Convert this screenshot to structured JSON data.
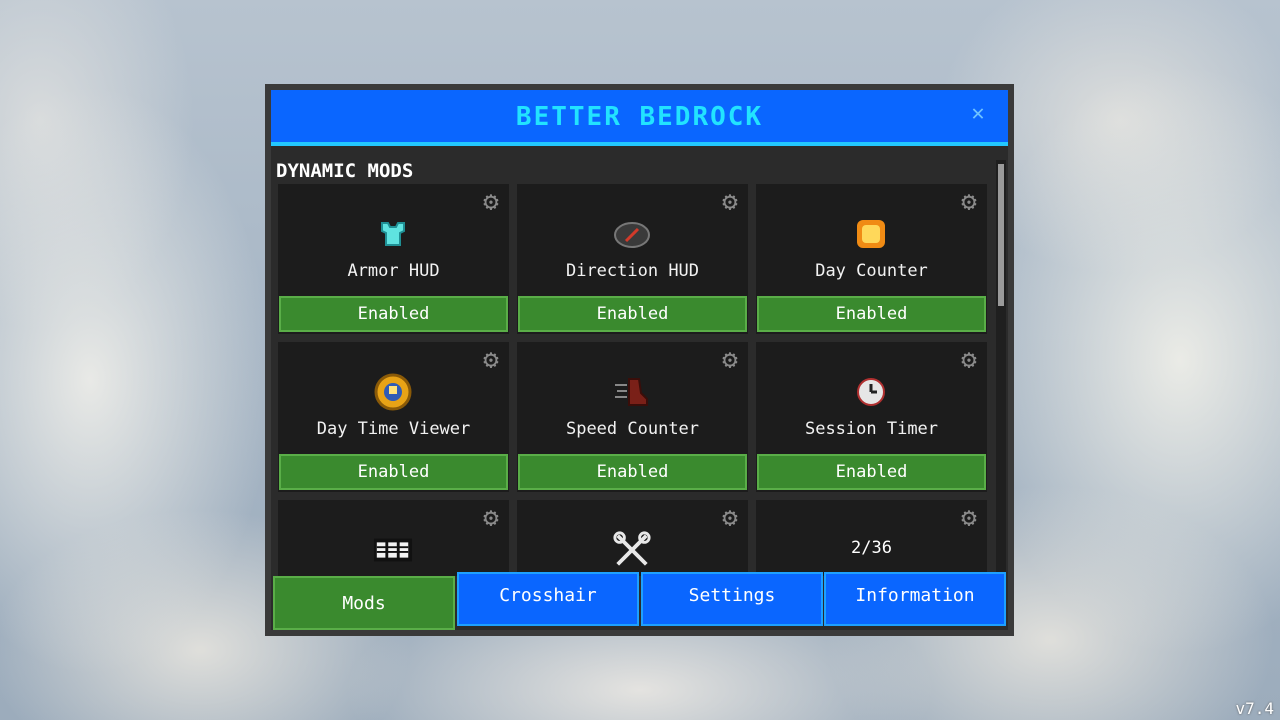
{
  "window": {
    "title": "BETTER BEDROCK",
    "close_icon": "close-icon",
    "version": "v7.4"
  },
  "section": {
    "label": "DYNAMIC MODS"
  },
  "mods": [
    {
      "name": "Armor HUD",
      "status": "Enabled",
      "icon": "armor-icon"
    },
    {
      "name": "Direction HUD",
      "status": "Enabled",
      "icon": "compass-icon"
    },
    {
      "name": "Day Counter",
      "status": "Enabled",
      "icon": "sun-icon"
    },
    {
      "name": "Day Time Viewer",
      "status": "Enabled",
      "icon": "clock-icon"
    },
    {
      "name": "Speed Counter",
      "status": "Enabled",
      "icon": "speed-boot-icon"
    },
    {
      "name": "Session Timer",
      "status": "Enabled",
      "icon": "timer-icon"
    },
    {
      "name": "",
      "status": "",
      "icon": "inventory-bars-icon"
    },
    {
      "name": "",
      "status": "",
      "icon": "wrench-tools-icon"
    },
    {
      "name": "",
      "status": "",
      "icon": "",
      "counter": "2/36"
    }
  ],
  "tabs": [
    {
      "label": "Mods",
      "active": true
    },
    {
      "label": "Crosshair",
      "active": false
    },
    {
      "label": "Settings",
      "active": false
    },
    {
      "label": "Information",
      "active": false
    }
  ],
  "colors": {
    "title_bar": "#0a66ff",
    "title_text": "#22e3ff",
    "enabled": "#3a8a2e",
    "tab_inactive": "#0a66ff"
  }
}
